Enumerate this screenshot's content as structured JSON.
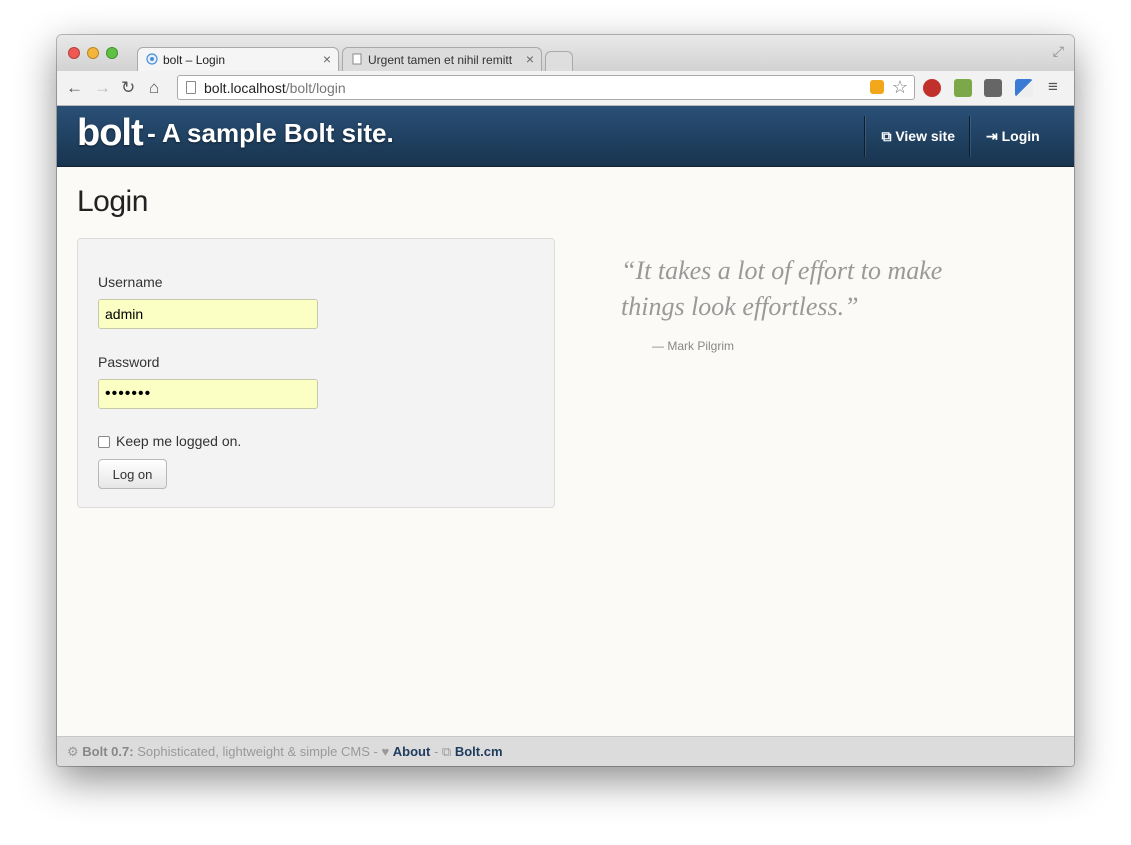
{
  "browser": {
    "tabs": [
      {
        "title": "bolt – Login",
        "active": true
      },
      {
        "title": "Urgent tamen et nihil remitt",
        "active": false
      }
    ],
    "url": {
      "host": "bolt.localhost",
      "path": "/bolt/login"
    }
  },
  "header": {
    "brand_name": "bolt",
    "tagline": "- A sample Bolt site.",
    "nav": {
      "view_site": "View site",
      "login": "Login"
    }
  },
  "main": {
    "title": "Login",
    "form": {
      "username_label": "Username",
      "username_value": "admin",
      "password_label": "Password",
      "password_value": "•••••••",
      "remember_label": "Keep me logged on.",
      "submit_label": "Log on"
    },
    "quote": {
      "text": "“It takes a lot of effort to make things look effortless.”",
      "author": "— Mark Pilgrim"
    }
  },
  "footer": {
    "version": "Bolt 0.7:",
    "description": "Sophisticated, lightweight & simple CMS -",
    "about": "About",
    "separator": "-",
    "site_link": "Bolt.cm"
  },
  "colors": {
    "header_bg": "#1e3d5c",
    "autofill_bg": "#fbffc4",
    "footer_link": "#1f3b5e"
  }
}
